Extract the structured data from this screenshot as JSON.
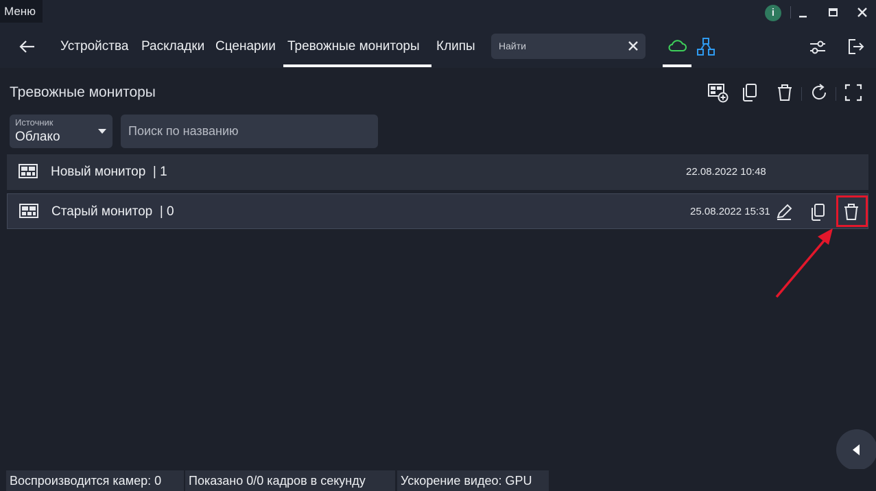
{
  "titlebar": {
    "menu_label": "Меню",
    "info_label": "i"
  },
  "nav": {
    "tabs": [
      {
        "label": "Устройства"
      },
      {
        "label": "Раскладки"
      },
      {
        "label": "Сценарии"
      },
      {
        "label": "Тревожные мониторы",
        "active": true
      },
      {
        "label": "Клипы"
      }
    ],
    "search_placeholder": "Найти"
  },
  "page": {
    "title": "Тревожные мониторы",
    "source": {
      "label": "Источник",
      "value": "Облако"
    },
    "name_search_placeholder": "Поиск по названию"
  },
  "monitors": [
    {
      "name": "Новый монитор",
      "count_label": "| 1",
      "date": "22.08.2022 10:48"
    },
    {
      "name": "Старый монитор",
      "count_label": "| 0",
      "date": "25.08.2022 15:31",
      "selected": true
    }
  ],
  "status": {
    "cameras": "Воспроизводится камер: 0",
    "frames": "Показано 0/0 кадров в секунду",
    "accel": "Ускорение видео: GPU"
  },
  "colors": {
    "background": "#1f2430",
    "panel": "#2b303c",
    "accent_cloud": "#3ecf5a",
    "accent_network": "#2f9bf0",
    "highlight": "#e3172b"
  }
}
